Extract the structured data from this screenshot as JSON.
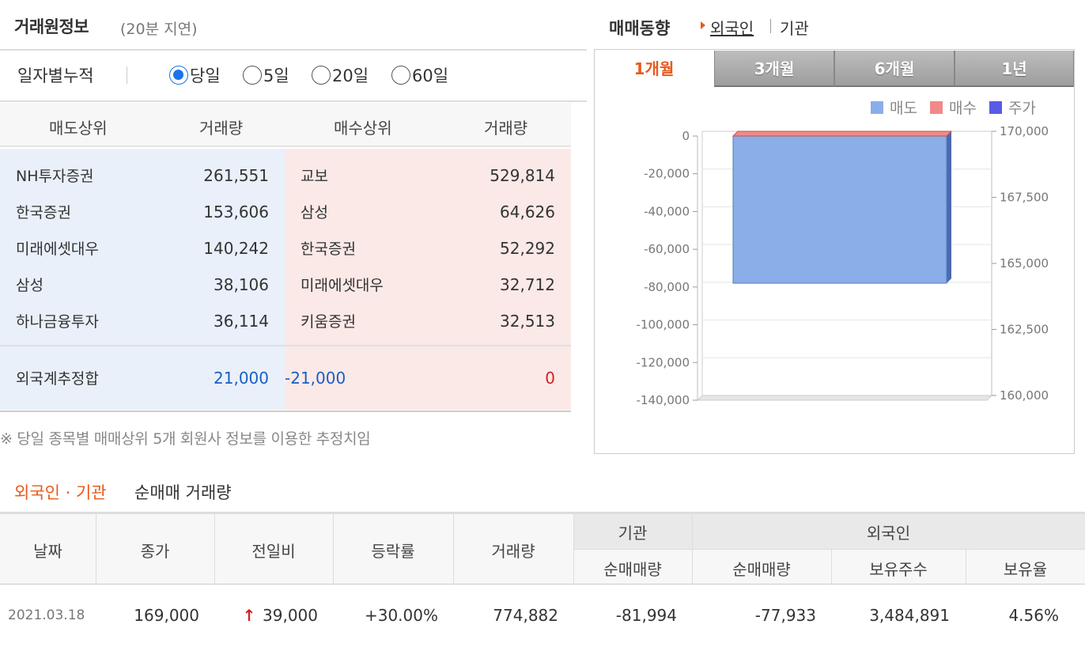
{
  "left": {
    "title": "거래원정보",
    "subtitle": "(20분 지연)",
    "period_label": "일자별누적",
    "periods": [
      {
        "label": "당일",
        "checked": true
      },
      {
        "label": "5일",
        "checked": false
      },
      {
        "label": "20일",
        "checked": false
      },
      {
        "label": "60일",
        "checked": false
      }
    ],
    "table_headers": [
      "매도상위",
      "거래량",
      "매수상위",
      "거래량"
    ],
    "rows": [
      {
        "sell": "NH투자증권",
        "sell_vol": "261,551",
        "buy": "교보",
        "buy_vol": "529,814"
      },
      {
        "sell": "한국증권",
        "sell_vol": "153,606",
        "buy": "삼성",
        "buy_vol": "64,626"
      },
      {
        "sell": "미래에셋대우",
        "sell_vol": "140,242",
        "buy": "한국증권",
        "buy_vol": "52,292"
      },
      {
        "sell": "삼성",
        "sell_vol": "38,106",
        "buy": "미래에셋대우",
        "buy_vol": "32,712"
      },
      {
        "sell": "하나금융투자",
        "sell_vol": "36,114",
        "buy": "키움증권",
        "buy_vol": "32,513"
      }
    ],
    "foreign": {
      "label": "외국계추정합",
      "sell_vol": "21,000",
      "buy_vol": "-21,000",
      "net": "0"
    },
    "note": "※ 당일 종목별 매매상위 5개 회원사 정보를 이용한 추정치임"
  },
  "trend": {
    "title": "매매동향",
    "link_foreign": "외국인",
    "link_inst": "기관",
    "tabs": [
      {
        "label": "1개월",
        "active": true
      },
      {
        "label": "3개월",
        "active": false
      },
      {
        "label": "6개월",
        "active": false
      },
      {
        "label": "1년",
        "active": false
      }
    ],
    "legend": [
      {
        "label": "매도",
        "color": "#8aaee8"
      },
      {
        "label": "매수",
        "color": "#f08a8a"
      },
      {
        "label": "주가",
        "color": "#5a5ae8"
      }
    ]
  },
  "chart_data": {
    "type": "bar",
    "series": [
      {
        "name": "매도",
        "values": [
          -78000
        ],
        "color": "#8aaee8"
      },
      {
        "name": "매수",
        "values": [
          0
        ],
        "color": "#f08a8a"
      }
    ],
    "ylim": [
      -140000,
      0
    ],
    "y_ticks": [
      "0",
      "-20,000",
      "-40,000",
      "-60,000",
      "-80,000",
      "-100,000",
      "-120,000",
      "-140,000"
    ],
    "y2lim": [
      160000,
      170000
    ],
    "y2_ticks": [
      "170,000",
      "167,500",
      "165,000",
      "162,500",
      "160,000"
    ],
    "grid": true
  },
  "bottom": {
    "title_a": "외국인 · 기관",
    "title_b": "순매매 거래량",
    "headers": {
      "date": "날짜",
      "close": "종가",
      "change": "전일비",
      "rate": "등락률",
      "volume": "거래량",
      "inst": "기관",
      "foreign": "외국인",
      "inst_net": "순매매량",
      "foreign_net": "순매매량",
      "holding": "보유주수",
      "ratio": "보유율"
    },
    "row": {
      "date": "2021.03.18",
      "close": "169,000",
      "change": "39,000",
      "rate": "+30.00%",
      "volume": "774,882",
      "inst_net": "-81,994",
      "foreign_net": "-77,933",
      "holding": "3,484,891",
      "ratio": "4.56%"
    }
  }
}
